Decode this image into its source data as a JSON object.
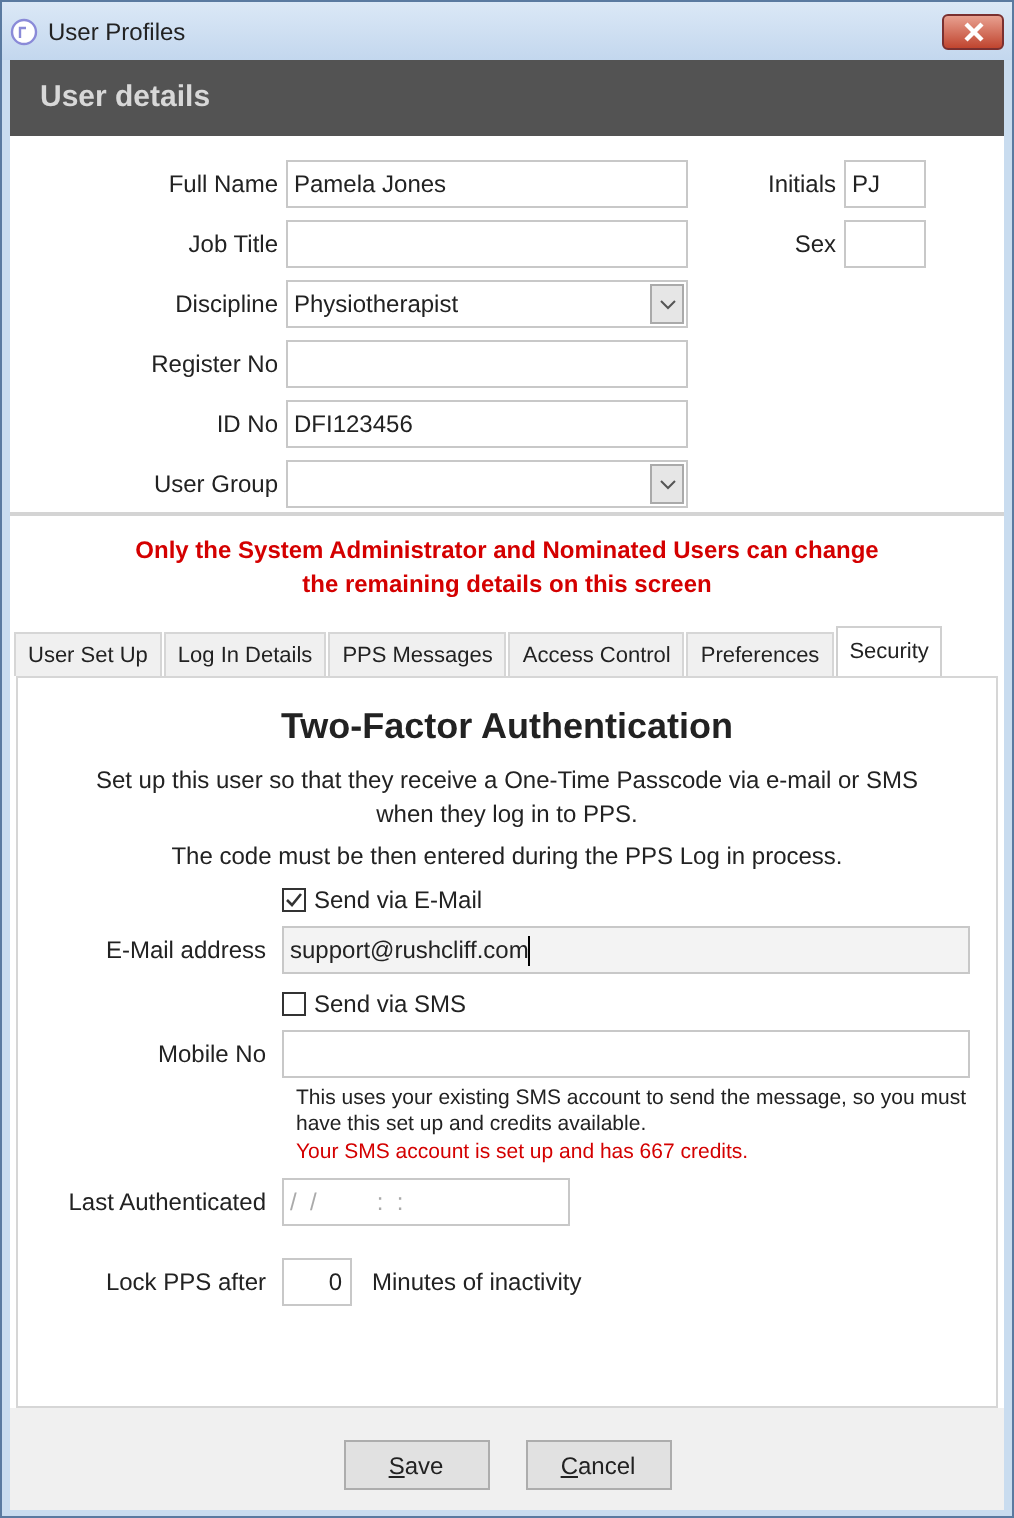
{
  "window": {
    "title": "User Profiles"
  },
  "header": "User details",
  "details_fields": [
    {
      "label": "Full Name",
      "value": "Pamela Jones",
      "kind": "text"
    },
    {
      "label": "Job Title",
      "kind": "text"
    },
    {
      "label": "Discipline",
      "value": "Physiotherapist",
      "kind": "dropdown"
    },
    {
      "label": "Register No",
      "kind": "text"
    },
    {
      "label": "ID No",
      "value": "DFI123456",
      "kind": "text"
    },
    {
      "label": "User Group",
      "kind": "dropdown"
    }
  ],
  "side_fields": [
    {
      "label": "Initials",
      "value": "PJ"
    },
    {
      "label": "Sex"
    }
  ],
  "notice": "Only the System Administrator and Nominated Users can change the remaining details on this screen",
  "tabs": [
    {
      "label": "User Set Up",
      "selected": false
    },
    {
      "label": "Log In Details",
      "selected": false
    },
    {
      "label": "PPS Messages",
      "selected": false
    },
    {
      "label": "Access Control",
      "selected": false
    },
    {
      "label": "Preferences",
      "selected": false
    },
    {
      "label": "Security",
      "selected": true
    }
  ],
  "security": {
    "title": "Two-Factor Authentication",
    "intro": "Set up this user so that they receive a One-Time Passcode via e-mail or SMS when they log in to PPS.",
    "intro_2": "The code must be then entered during the PPS Log in process.",
    "email_checkbox": {
      "label": "Send via E-Mail",
      "checked": true
    },
    "email_field": {
      "label": "E-Mail address",
      "value": "support@rushcliff.com"
    },
    "sms_checkbox": {
      "label": "Send via SMS",
      "checked": false
    },
    "mobile_field": {
      "label": "Mobile No"
    },
    "sms_note": "This uses your existing SMS account to send the message, so you must have this set up and credits available.",
    "sms_status": "Your SMS account is set up and has 667 credits.",
    "last_authenticated": {
      "label": "Last Authenticated",
      "placeholder": "/  /         :  :"
    },
    "lock": {
      "label": "Lock PPS after",
      "value": "0",
      "suffix": "Minutes of inactivity"
    }
  },
  "buttons": [
    "Save",
    "Cancel"
  ]
}
